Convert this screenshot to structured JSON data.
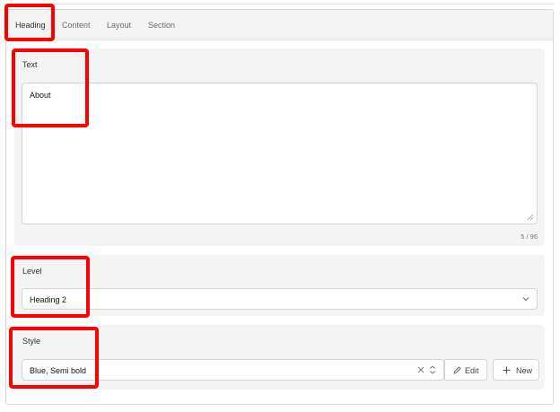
{
  "tabs": [
    {
      "label": "Heading",
      "active": true
    },
    {
      "label": "Content",
      "active": false
    },
    {
      "label": "Layout",
      "active": false
    },
    {
      "label": "Section",
      "active": false
    }
  ],
  "text_section": {
    "label": "Text",
    "value": "About",
    "counter": "5 / 96"
  },
  "level_section": {
    "label": "Level",
    "selected": "Heading 2",
    "icon": "chevron-down-icon"
  },
  "style_section": {
    "label": "Style",
    "selected": "Blue, Semi bold",
    "clear_icon": "close-icon",
    "sort_icon": "up-down-chevron-icon",
    "edit_label": "Edit",
    "edit_icon": "pencil-icon",
    "new_label": "New",
    "new_icon": "plus-icon"
  },
  "colors": {
    "accent": "#6a3aa8",
    "highlight": "#ff0000",
    "section_bg": "#f4f4f4"
  }
}
